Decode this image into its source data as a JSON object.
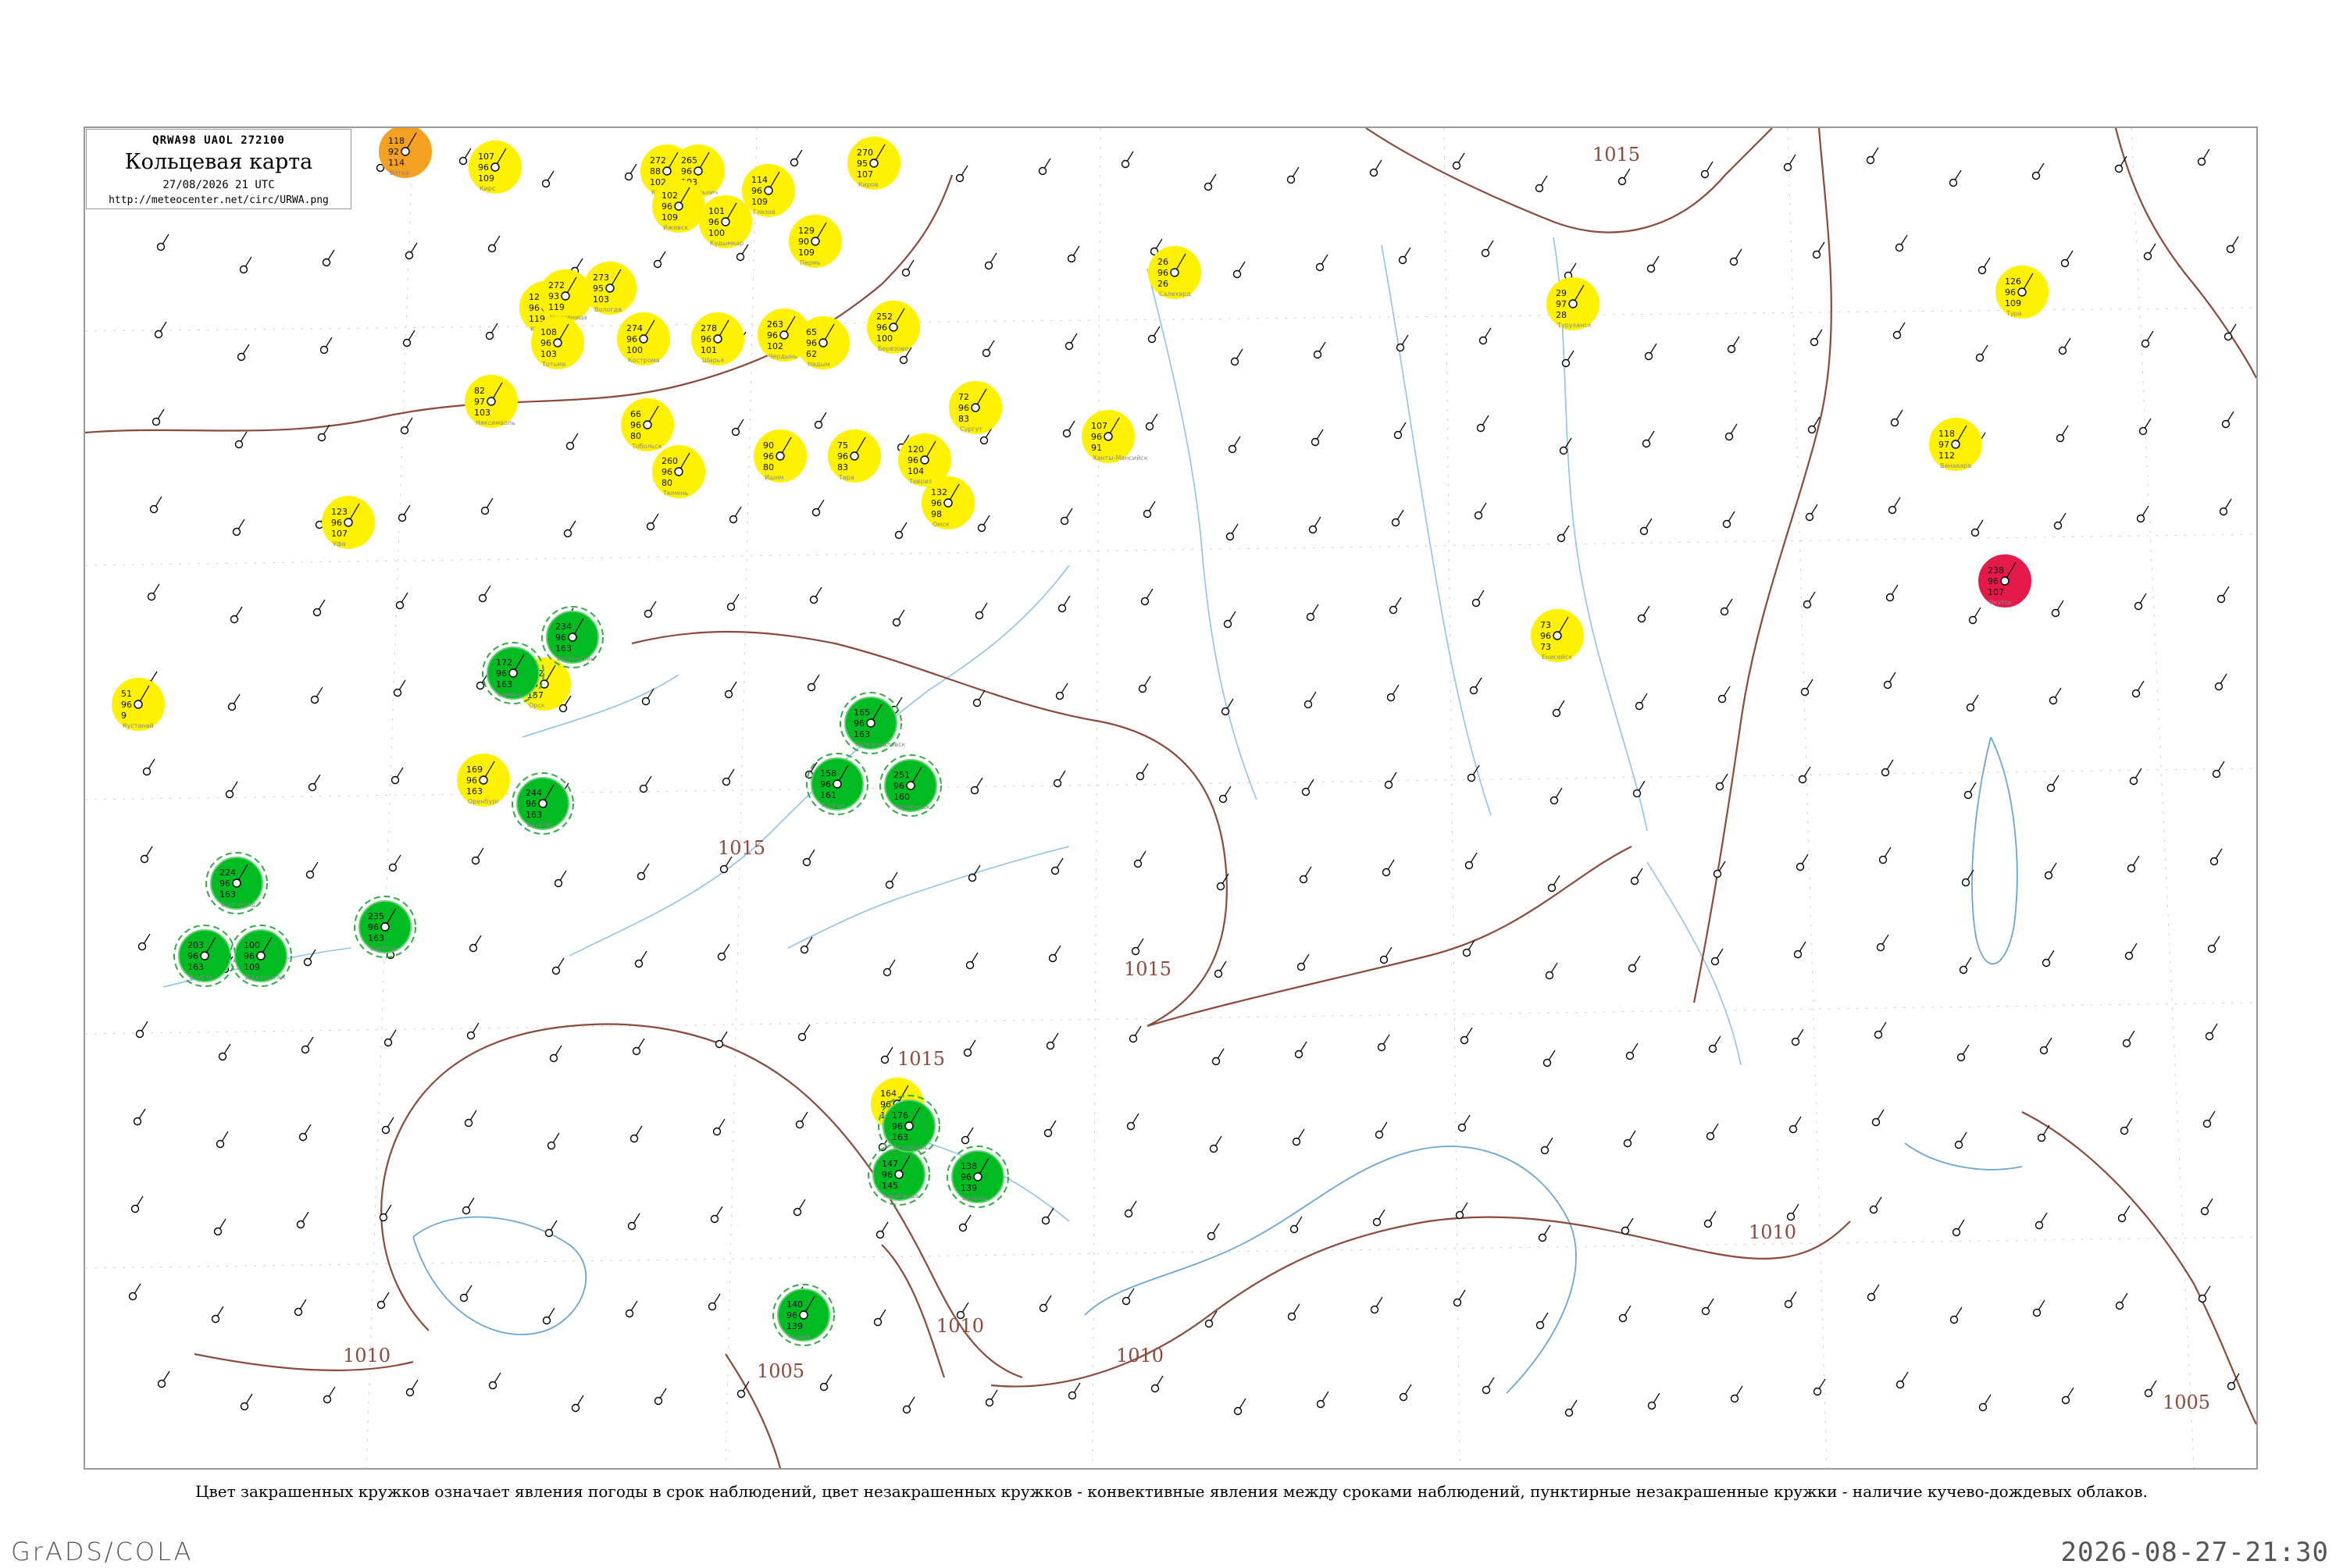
{
  "header": {
    "codes": "QRWA98  UAOL  272100",
    "title": "Кольцевая карта",
    "date": "27/08/2026 21 UTC",
    "url": "http://meteocenter.net/circ/URWA.png"
  },
  "caption": "Цвет закрашенных кружков означает явления погоды в срок наблюдений, цвет незакрашенных кружков - конвективные явления между сроками наблюдений, пунктирные незакрашенные кружки - наличие кучево-дождевых облаков.",
  "footer": {
    "left": "GrADS/COLA",
    "right": "2026-08-27-21:30"
  },
  "colors": {
    "rain": "#00bb22",
    "fog": "#fff200",
    "snow": "#e6194b",
    "haze": "#f4a020",
    "cb_dashed": "#33aa44",
    "thunder_ring": "#e04060",
    "isobar": "#8b4a3a",
    "water": "#8fc3e8"
  },
  "isobar_labels": [
    "1015",
    "1015",
    "1015",
    "1015",
    "1010",
    "1010",
    "1010",
    "1005",
    "1010",
    "1005"
  ],
  "stations": [
    {
      "p": "118",
      "t": "92",
      "d": "114",
      "name": "Вятка",
      "fill": "haze"
    },
    {
      "p": "107",
      "t": "96",
      "d": "109",
      "name": "Кирс",
      "fill": "fog"
    },
    {
      "p": "272",
      "t": "88",
      "d": "102",
      "name": "Киров",
      "fill": "fog"
    },
    {
      "p": "265",
      "t": "96",
      "d": "103",
      "name": "Котельнич",
      "fill": "fog"
    },
    {
      "p": "270",
      "t": "95",
      "d": "107",
      "name": "Киров",
      "fill": "fog"
    },
    {
      "p": "114",
      "t": "96",
      "d": "109",
      "name": "Глазов",
      "fill": "fog"
    },
    {
      "p": "102",
      "t": "96",
      "d": "109",
      "name": "Ижевск",
      "fill": "fog"
    },
    {
      "p": "101",
      "t": "96",
      "d": "100",
      "name": "Кудымкар",
      "fill": "fog"
    },
    {
      "p": "129",
      "t": "90",
      "d": "109",
      "name": "Пермь",
      "fill": "fog"
    },
    {
      "p": "120",
      "t": "96",
      "d": "119",
      "name": "Котлас",
      "fill": "fog"
    },
    {
      "p": "272",
      "t": "93",
      "d": "119",
      "name": "Нюксеница",
      "fill": "fog"
    },
    {
      "p": "273",
      "t": "95",
      "d": "103",
      "name": "Вологда",
      "fill": "fog"
    },
    {
      "p": "108",
      "t": "96",
      "d": "103",
      "name": "Тотьма",
      "fill": "fog"
    },
    {
      "p": "274",
      "t": "96",
      "d": "100",
      "name": "Кострома",
      "fill": "fog"
    },
    {
      "p": "278",
      "t": "96",
      "d": "101",
      "name": "Шарья",
      "fill": "fog"
    },
    {
      "p": "263",
      "t": "96",
      "d": "102",
      "name": "Чердынь",
      "fill": "fog"
    },
    {
      "p": "65",
      "t": "96",
      "d": "62",
      "name": "Надым",
      "fill": "fog"
    },
    {
      "p": "252",
      "t": "96",
      "d": "100",
      "name": "Березово",
      "fill": "fog"
    },
    {
      "p": "82",
      "t": "97",
      "d": "103",
      "name": "Няксимволь",
      "fill": "fog"
    },
    {
      "p": "66",
      "t": "96",
      "d": "80",
      "name": "Тобольск",
      "fill": "fog"
    },
    {
      "p": "260",
      "t": "96",
      "d": "80",
      "name": "Тюмень",
      "fill": "fog"
    },
    {
      "p": "90",
      "t": "96",
      "d": "80",
      "name": "Ишим",
      "fill": "fog"
    },
    {
      "p": "75",
      "t": "96",
      "d": "83",
      "name": "Тара",
      "fill": "fog"
    },
    {
      "p": "120",
      "t": "96",
      "d": "104",
      "name": "Тевриз",
      "fill": "fog"
    },
    {
      "p": "132",
      "t": "96",
      "d": "98",
      "name": "Омск",
      "fill": "fog"
    },
    {
      "p": "72",
      "t": "96",
      "d": "83",
      "name": "Сургут",
      "fill": "fog"
    },
    {
      "p": "107",
      "t": "96",
      "d": "91",
      "name": "Ханты-Мансийск",
      "fill": "fog"
    },
    {
      "p": "123",
      "t": "96",
      "d": "107",
      "name": "Уфа",
      "fill": "fog"
    },
    {
      "p": "162",
      "t": "96",
      "d": "157",
      "name": "Орск",
      "fill": "fog"
    },
    {
      "p": "169",
      "t": "96",
      "d": "163",
      "name": "Оренбург",
      "fill": "fog"
    },
    {
      "p": "51",
      "t": "96",
      "d": "9",
      "name": "Кустанай",
      "fill": "fog"
    },
    {
      "p": "26",
      "t": "96",
      "d": "26",
      "name": "Салехард",
      "fill": "fog"
    },
    {
      "p": "29",
      "t": "97",
      "d": "28",
      "name": "Туруханск",
      "fill": "fog"
    },
    {
      "p": "73",
      "t": "96",
      "d": "73",
      "name": "Енисейск",
      "fill": "fog"
    },
    {
      "p": "126",
      "t": "96",
      "d": "109",
      "name": "Тура",
      "fill": "fog"
    },
    {
      "p": "118",
      "t": "97",
      "d": "112",
      "name": "Ванавара",
      "fill": "fog"
    },
    {
      "p": "164",
      "t": "96",
      "d": "164",
      "name": "Кокшетау",
      "fill": "fog"
    },
    {
      "p": "238",
      "t": "96",
      "d": "107",
      "name": "Якутск",
      "fill": "snow"
    },
    {
      "p": "172",
      "t": "96",
      "d": "163",
      "name": "Самара",
      "fill": "rain"
    },
    {
      "p": "234",
      "t": "96",
      "d": "163",
      "name": "Бугуруслан",
      "fill": "rain"
    },
    {
      "p": "244",
      "t": "96",
      "d": "163",
      "name": "Бузулук",
      "fill": "rain"
    },
    {
      "p": "235",
      "t": "96",
      "d": "163",
      "name": "Саратов",
      "fill": "rain"
    },
    {
      "p": "224",
      "t": "96",
      "d": "163",
      "name": "Волгоград",
      "fill": "rain"
    },
    {
      "p": "203",
      "t": "96",
      "d": "163",
      "name": "Элиста",
      "fill": "rain"
    },
    {
      "p": "165",
      "t": "96",
      "d": "163",
      "name": "Петропавловск",
      "fill": "rain"
    },
    {
      "p": "158",
      "t": "96",
      "d": "161",
      "name": "Курган",
      "fill": "rain"
    },
    {
      "p": "251",
      "t": "96",
      "d": "160",
      "name": "Челябинск",
      "fill": "rain"
    },
    {
      "p": "147",
      "t": "96",
      "d": "145",
      "name": "Караганда",
      "fill": "rain"
    },
    {
      "p": "138",
      "t": "96",
      "d": "139",
      "name": "Балхаш",
      "fill": "rain"
    },
    {
      "p": "100",
      "t": "96",
      "d": "109",
      "name": "Джезказган",
      "fill": "rain"
    },
    {
      "p": "176",
      "t": "96",
      "d": "163",
      "name": "Астрахань",
      "fill": "rain"
    },
    {
      "p": "140",
      "t": "96",
      "d": "139",
      "name": "Гурьев",
      "fill": "rain"
    }
  ]
}
